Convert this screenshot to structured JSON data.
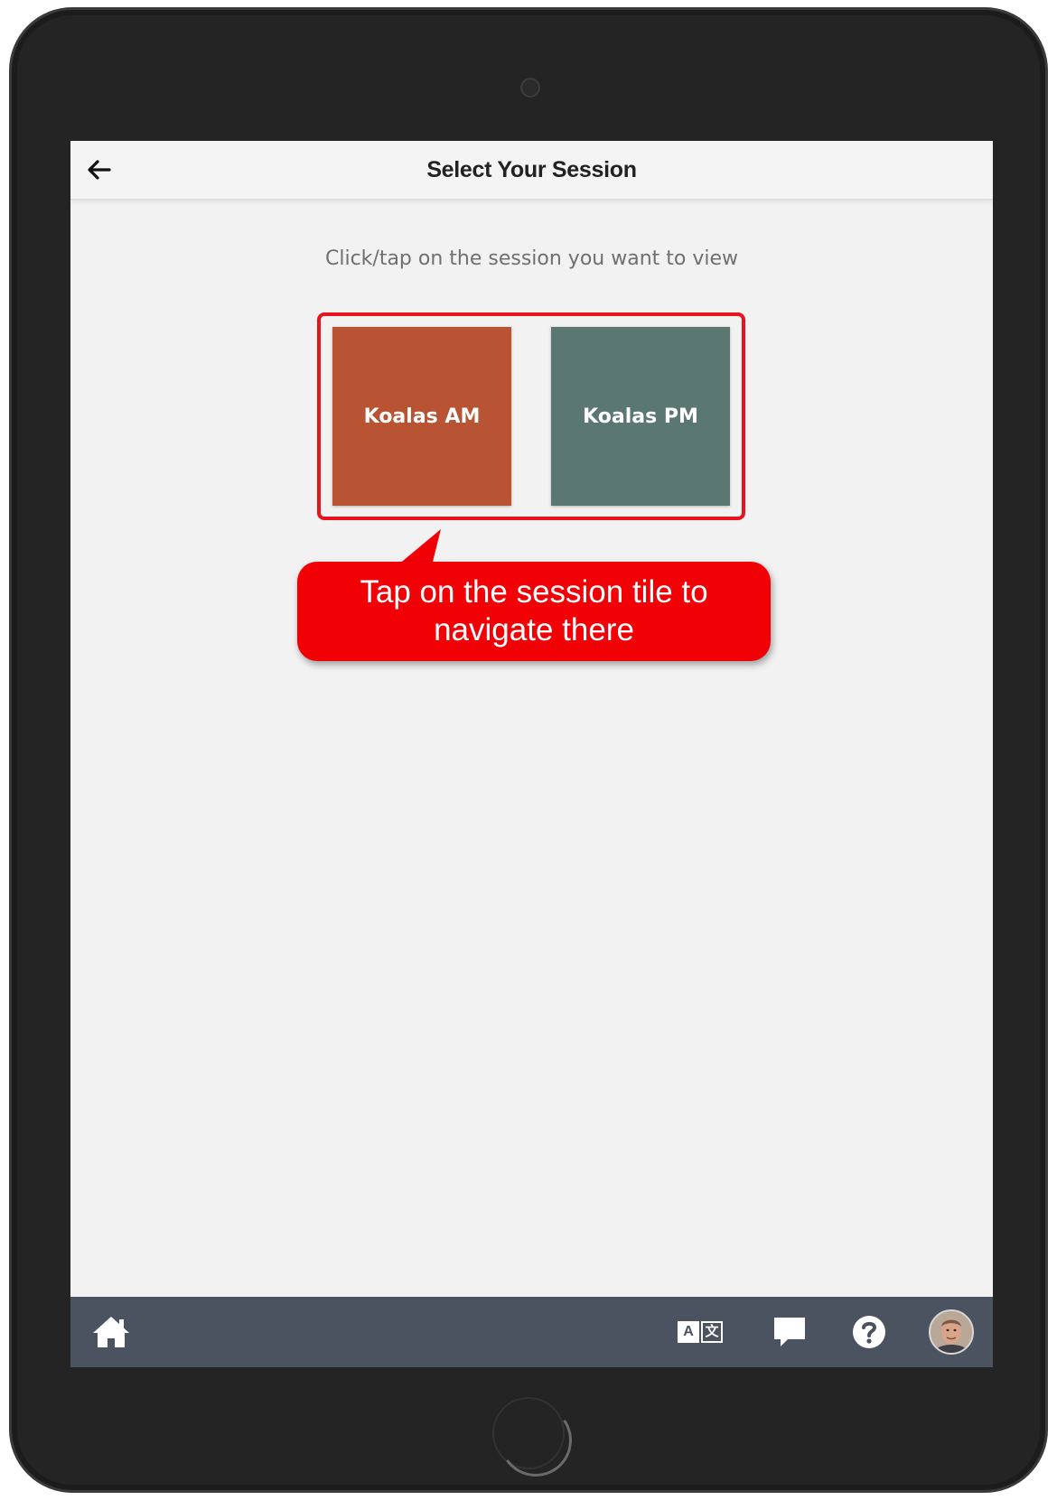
{
  "header": {
    "title": "Select Your Session",
    "back_icon": "arrow-left-icon"
  },
  "instructions": "Click/tap on the session you want to view",
  "sessions": [
    {
      "label": "Koalas AM",
      "color": "#b85433"
    },
    {
      "label": "Koalas PM",
      "color": "#5b7771"
    }
  ],
  "callout": {
    "text": "Tap on the session tile to navigate there",
    "color": "#f10006"
  },
  "bottom_bar": {
    "home_icon": "home-icon",
    "translate_icon": "translate-icon",
    "translate_glyphs": [
      "A",
      "文"
    ],
    "chat_icon": "chat-bubble-icon",
    "help_icon": "help-circle-icon",
    "avatar": "user-avatar"
  },
  "colors": {
    "highlight": "#e8131c",
    "bottom_bar": "#4b5260",
    "screen_bg": "#f2f2f2"
  }
}
